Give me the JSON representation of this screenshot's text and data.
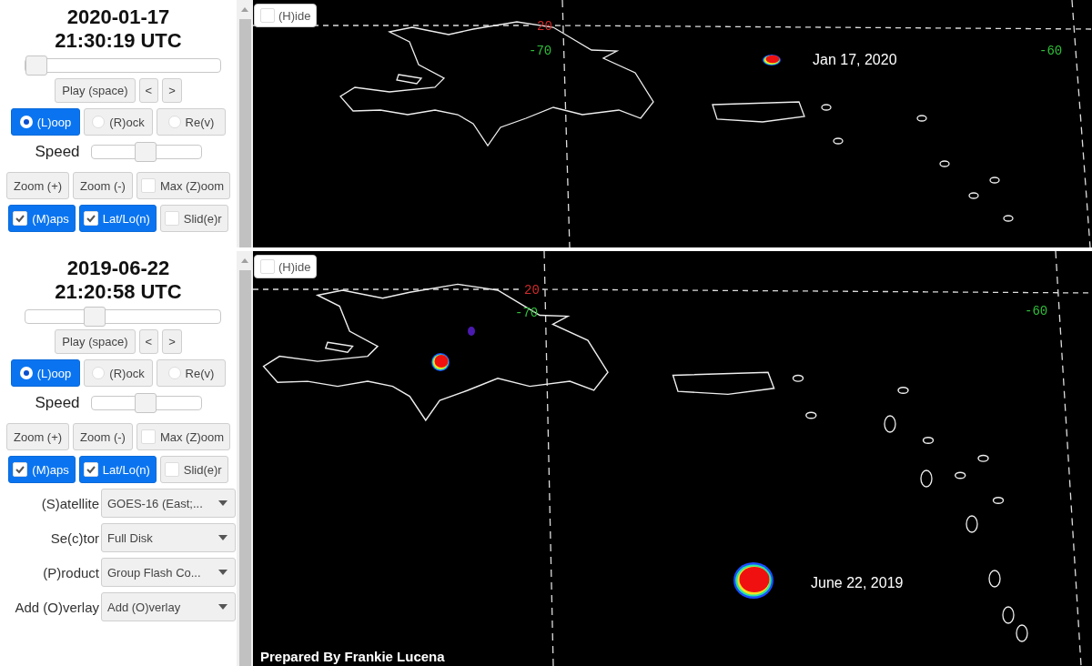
{
  "panels": [
    {
      "date": "2020-01-17",
      "time": "21:30:19 UTC",
      "time_slider": {
        "level": 0
      },
      "play_button": "Play (space)",
      "step_buttons": [
        "<",
        ">"
      ],
      "modes": [
        {
          "label": "(L)oop",
          "selected": true
        },
        {
          "label": "(R)ock",
          "selected": false
        },
        {
          "label": "Re(v)",
          "selected": false
        }
      ],
      "speed": {
        "label": "Speed",
        "level": 0.5
      },
      "zoom_row": [
        {
          "kind": "button",
          "label": "Zoom (+)"
        },
        {
          "kind": "button",
          "label": "Zoom (-)"
        },
        {
          "kind": "toggle",
          "label": "Max (Z)oom",
          "checked": false
        }
      ],
      "toggles": [
        {
          "label": "(M)aps",
          "checked": true
        },
        {
          "label": "Lat/Lo(n)",
          "checked": true
        },
        {
          "label": "Slid(e)r",
          "checked": false
        }
      ],
      "map": {
        "hide": {
          "label": "(H)ide",
          "checked": false
        },
        "grid_labels": [
          {
            "kind": "lat",
            "text": "20"
          },
          {
            "kind": "lon",
            "text": "-70"
          },
          {
            "kind": "lon",
            "text": "-60"
          }
        ],
        "caption": "Jan 17, 2020"
      }
    },
    {
      "date": "2019-06-22",
      "time": "21:20:58 UTC",
      "time_slider": {
        "level": 0.34
      },
      "play_button": "Play (space)",
      "step_buttons": [
        "<",
        ">"
      ],
      "modes": [
        {
          "label": "(L)oop",
          "selected": true
        },
        {
          "label": "(R)ock",
          "selected": false
        },
        {
          "label": "Re(v)",
          "selected": false
        }
      ],
      "speed": {
        "label": "Speed",
        "level": 0.5
      },
      "zoom_row": [
        {
          "kind": "button",
          "label": "Zoom (+)"
        },
        {
          "kind": "button",
          "label": "Zoom (-)"
        },
        {
          "kind": "toggle",
          "label": "Max (Z)oom",
          "checked": false
        }
      ],
      "toggles": [
        {
          "label": "(M)aps",
          "checked": true
        },
        {
          "label": "Lat/Lo(n)",
          "checked": true
        },
        {
          "label": "Slid(e)r",
          "checked": false
        }
      ],
      "selects": [
        {
          "label": "(S)atellite",
          "value": "GOES-16 (East;..."
        },
        {
          "label": "Se(c)tor",
          "value": "Full Disk"
        },
        {
          "label": "(P)roduct",
          "value": "Group Flash Co..."
        },
        {
          "label": "Add (O)verlay",
          "value": "Add (O)verlay"
        }
      ],
      "map": {
        "hide": {
          "label": "(H)ide",
          "checked": false
        },
        "grid_labels": [
          {
            "kind": "lat",
            "text": "20"
          },
          {
            "kind": "lon",
            "text": "-70"
          },
          {
            "kind": "lon",
            "text": "-60"
          }
        ],
        "caption": "June 22, 2019",
        "credit": "Prepared By Frankie Lucena"
      }
    }
  ]
}
